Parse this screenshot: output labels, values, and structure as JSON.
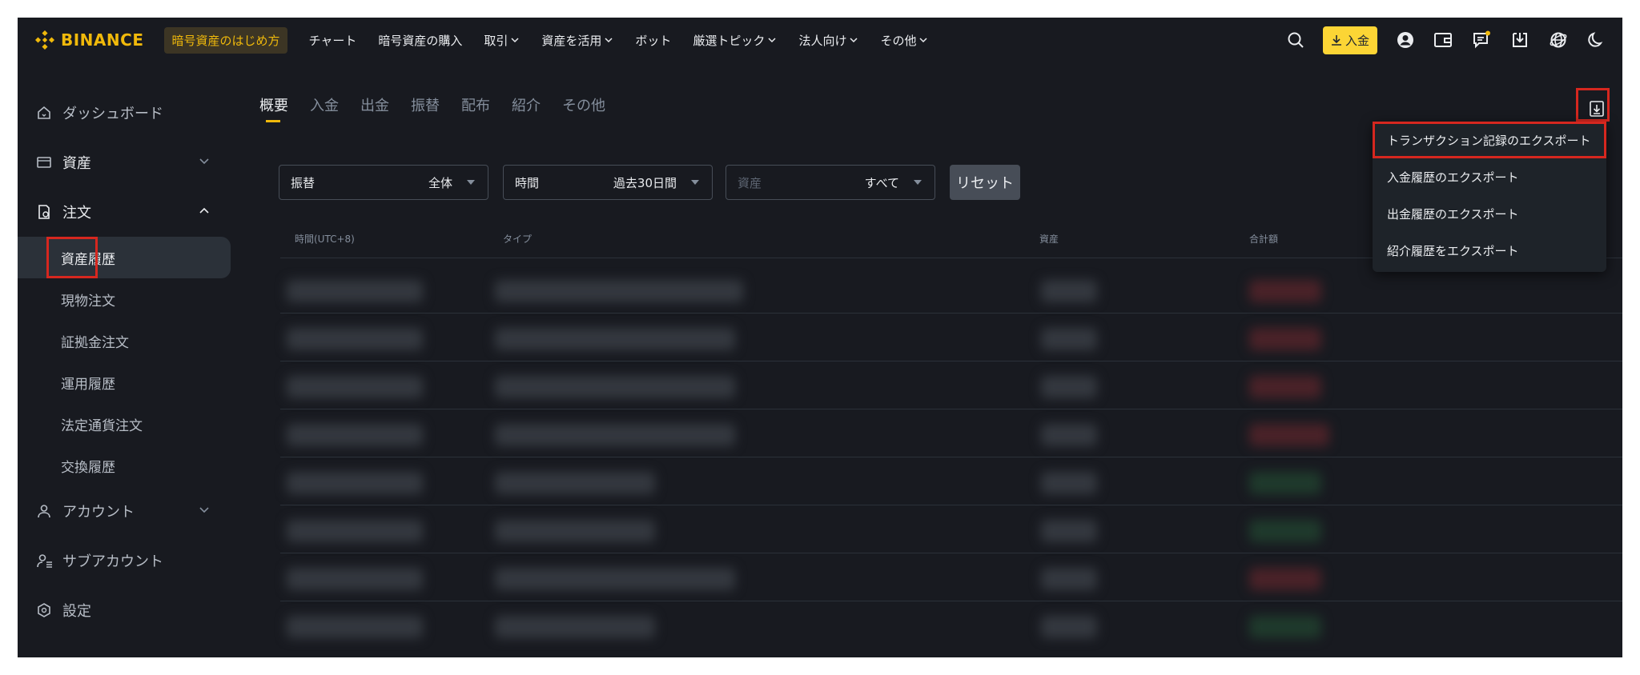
{
  "nav": {
    "brand": "BINANCE",
    "beginner": "暗号資産のはじめ方",
    "items": [
      {
        "label": "チャート",
        "dropdown": false
      },
      {
        "label": "暗号資産の購入",
        "dropdown": false
      },
      {
        "label": "取引",
        "dropdown": true
      },
      {
        "label": "資産を活用",
        "dropdown": true
      },
      {
        "label": "ボット",
        "dropdown": false
      },
      {
        "label": "厳選トピック",
        "dropdown": true
      },
      {
        "label": "法人向け",
        "dropdown": true
      },
      {
        "label": "その他",
        "dropdown": true
      }
    ],
    "deposit": "入金",
    "right_icons": [
      "search-icon",
      "user-icon",
      "wallet-icon",
      "message-icon",
      "download-icon",
      "globe-icon",
      "moon-icon"
    ]
  },
  "sidebar": {
    "dashboard": "ダッシュボード",
    "assets": "資産",
    "orders": "注文",
    "sub": [
      "資産履歴",
      "現物注文",
      "証拠金注文",
      "運用履歴",
      "法定通貨注文",
      "交換履歴"
    ],
    "account": "アカウント",
    "subaccount": "サブアカウント",
    "settings": "設定"
  },
  "tabs": [
    "概要",
    "入金",
    "出金",
    "振替",
    "配布",
    "紹介",
    "その他"
  ],
  "filters": {
    "type_label": "振替",
    "type_value": "全体",
    "time_label": "時間",
    "time_value": "過去30日間",
    "asset_label": "資産",
    "asset_value": "すべて",
    "reset": "リセット"
  },
  "table": {
    "headers": [
      "時間(UTC+8)",
      "タイプ",
      "資産",
      "合計額"
    ]
  },
  "export_menu": [
    "トランザクション記録のエクスポート",
    "入金履歴のエクスポート",
    "出金履歴のエクスポート",
    "紹介履歴をエクスポート"
  ],
  "colors": {
    "accent": "#f0b90b",
    "background": "#181a20",
    "highlight_box": "#d6271f"
  }
}
